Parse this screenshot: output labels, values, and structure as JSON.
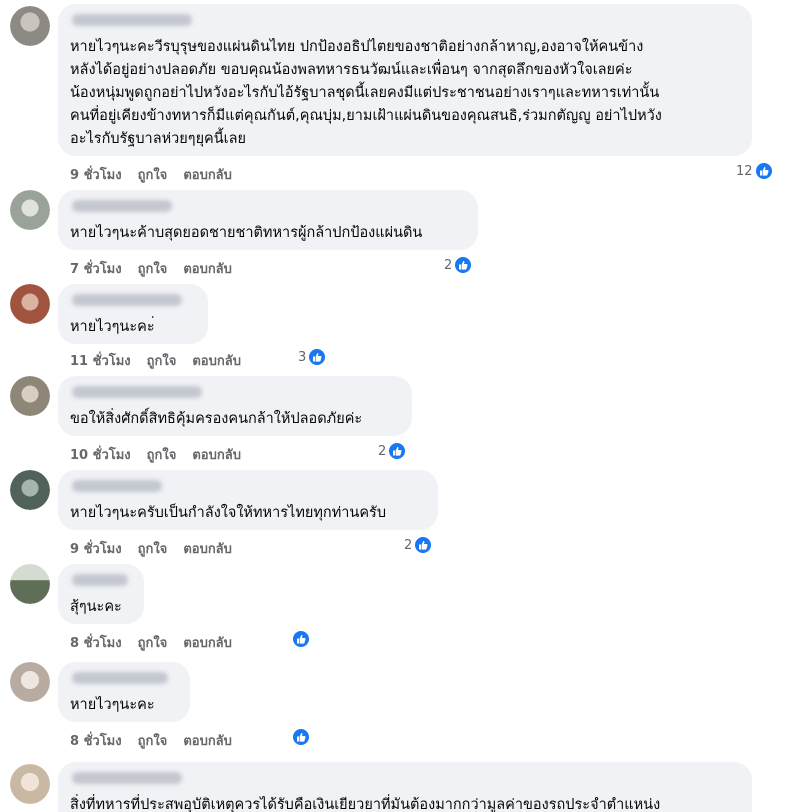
{
  "comments": [
    {
      "text": "หายไวๆนะคะวีรบุรุษของแผ่นดินไทย ปกป้องอธิปไตยของชาติอย่างกล้าหาญ,องอาจให้คนข้าง\nหลังได้อยู่อย่างปลอดภัย ขอบคุณน้องพลทหารธนวัฒน์และเพื่อนๆ จากสุดลึกของหัวใจเลยค่ะ\nน้องหนุ่มพูดถูกอย่าไปหวังอะไรกับไอ้รัฐบาลชุดนี้เลยคงมีแต่ประชาชนอย่างเราๆและทหารเท่านั้น\nคนที่อยู่เคียงข้างทหารก็มีแต่คุณกันต์,คุณบุ่ม,ยามเฝ้าแผ่นดินของคุณสนธิ,ร่วมกตัญญู อย่าไปหวัง\nอะไรกับรัฐบาลห่วยๆยุคนี้เลย",
      "time": "9 ชั่วโมง",
      "like": "ถูกใจ",
      "reply": "ตอบกลับ",
      "reactions": "12",
      "avatar_color": "#8d8a85"
    },
    {
      "text": "หายไวๆนะค้าบสุดยอดชายชาติทหารผู้กล้าปกป้องแผ่นดิน",
      "time": "7 ชั่วโมง",
      "like": "ถูกใจ",
      "reply": "ตอบกลับ",
      "reactions": "2",
      "avatar_color": "#9aa39a"
    },
    {
      "text": "หายไวๆนะคะ่",
      "time": "11 ชั่วโมง",
      "like": "ถูกใจ",
      "reply": "ตอบกลับ",
      "reactions": "3",
      "avatar_color": "#a0533e"
    },
    {
      "text": "ขอให้สิ่งศักดิ์สิทธิคุ้มครองคนกล้าให้ปลอดภัยค่ะ",
      "time": "10 ชั่วโมง",
      "like": "ถูกใจ",
      "reply": "ตอบกลับ",
      "reactions": "2",
      "avatar_color": "#8e8676"
    },
    {
      "text": "หายไวๆนะครับเป็นกำลังใจให้ทหารไทยทุกท่านครับ",
      "time": "9 ชั่วโมง",
      "like": "ถูกใจ",
      "reply": "ตอบกลับ",
      "reactions": "2",
      "avatar_color": "#51625a"
    },
    {
      "text": "สุ้ๆนะคะ",
      "time": "8 ชั่วโมง",
      "like": "ถูกใจ",
      "reply": "ตอบกลับ",
      "reactions": "",
      "avatar_color": "#5f6e56"
    },
    {
      "text": "หายไวๆนะคะ",
      "time": "8 ชั่วโมง",
      "like": "ถูกใจ",
      "reply": "ตอบกลับ",
      "reactions": "",
      "avatar_color": "#b8aba2"
    },
    {
      "text": "สิ่งที่ทหารที่ประสพอุบัติเหตุควรได้รับคือเงินเยียวยาที่มันต้องมากกว่ามูลค่าของรถประจำตำแหน่ง",
      "time": "",
      "like": "",
      "reply": "",
      "reactions": "",
      "avatar_color": "#c8b8a4"
    }
  ],
  "colors": {
    "bubble": "#f0f2f5",
    "like_blue": "#1877f2",
    "meta_text": "#65676b"
  },
  "icons": {
    "reaction": "thumbs-up-icon"
  }
}
